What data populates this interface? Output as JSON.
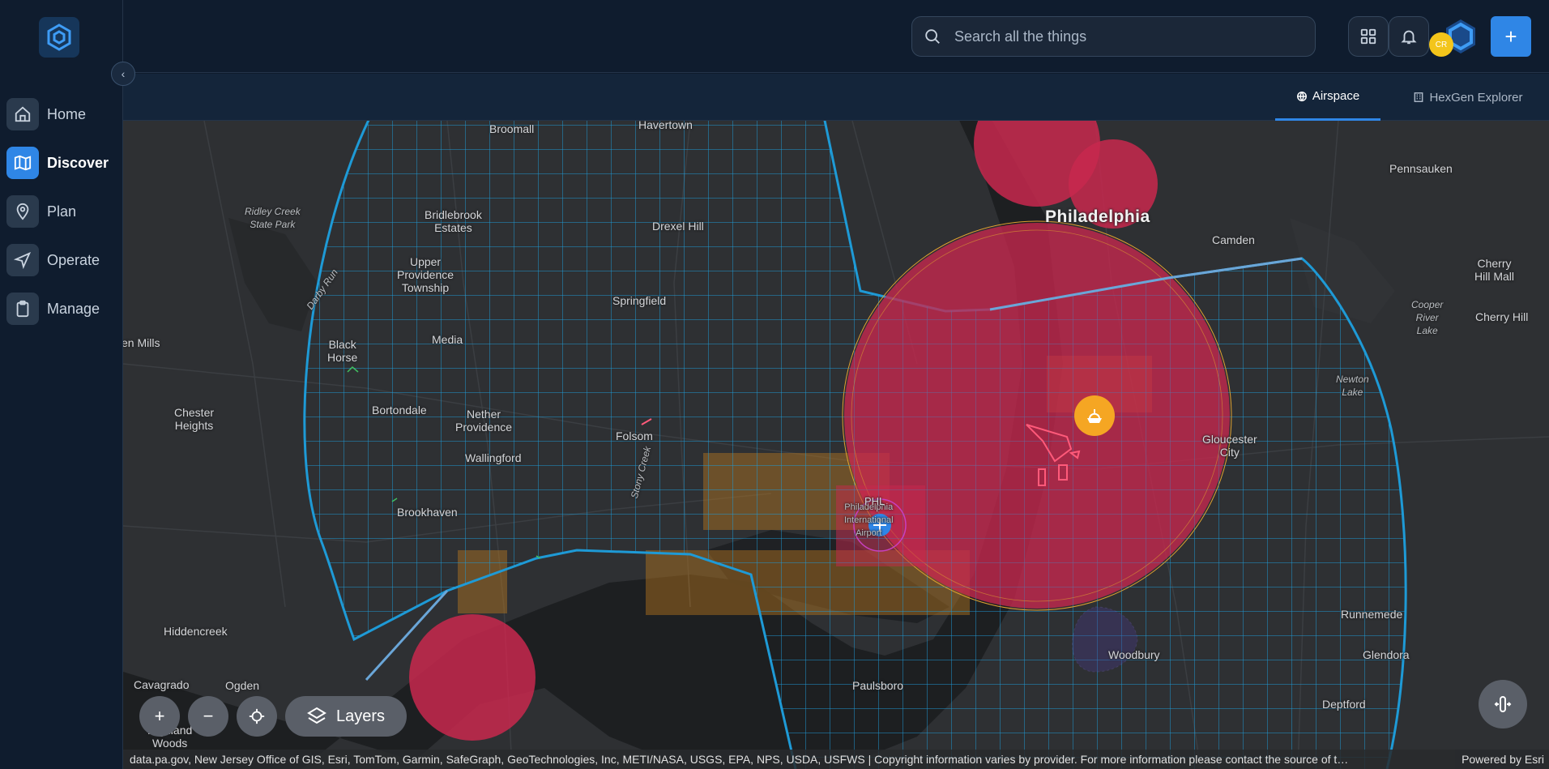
{
  "app": {
    "logo": "hexagon-logo-icon"
  },
  "sidebar": {
    "collapse_icon": "chevron-left-icon",
    "items": [
      {
        "label": "Home",
        "icon": "home-icon",
        "active": false
      },
      {
        "label": "Discover",
        "icon": "map-icon",
        "active": true
      },
      {
        "label": "Plan",
        "icon": "map-pin-icon",
        "active": false
      },
      {
        "label": "Operate",
        "icon": "send-icon",
        "active": false
      },
      {
        "label": "Manage",
        "icon": "clipboard-icon",
        "active": false
      }
    ]
  },
  "header": {
    "search_placeholder": "Search all the things",
    "avatar_initials": "CR",
    "accent": "#2f86e6"
  },
  "tabs": [
    {
      "label": "Airspace",
      "icon": "globe-icon",
      "active": true
    },
    {
      "label": "HexGen Explorer",
      "icon": "building-icon",
      "active": false
    }
  ],
  "map": {
    "places": {
      "broomall": "Broomall",
      "havertown": "Havertown",
      "pennsauken": "Pennsauken",
      "ridley": "Ridley Creek\nState Park",
      "bridlebrook": "Bridlebrook\nEstates",
      "drexel": "Drexel Hill",
      "philadelphia": "Philadelphia",
      "camden": "Camden",
      "cherry_mall": "Cherry\nHill Mall",
      "upper_providence": "Upper\nProvidence\nTownship",
      "darby_run": "Darby Run",
      "springfield": "Springfield",
      "cooper": "Cooper\nRiver\nLake",
      "cherry_hill": "Cherry Hill",
      "glen_mills": "en Mills",
      "black_horse": "Black\nHorse",
      "media": "Media",
      "newton": "Newton\nLake",
      "chester_heights": "Chester\nHeights",
      "bortondale": "Bortondale",
      "nether": "Nether\nProvidence",
      "folsom": "Folsom",
      "gloucester": "Gloucester\nCity",
      "wallingford": "Wallingford",
      "stony": "Stony Creek",
      "airport": "Philadelphia\nInternational\nAirport",
      "phl": "PHL",
      "brookhaven": "Brookhaven",
      "runnemede": "Runnemede",
      "hiddencreek": "Hiddencreek",
      "woodbury": "Woodbury",
      "glendora": "Glendora",
      "cavagrado": "Cavagrado",
      "ogden": "Ogden",
      "paulsboro": "Paulsboro",
      "deptford": "Deptford",
      "highland": "Highland\nWoods"
    },
    "controls": {
      "zoom_in": "+",
      "zoom_out": "−",
      "locate_icon": "crosshair-icon",
      "layers_label": "Layers",
      "layers_icon": "layers-icon",
      "rotate_icon": "compass-icon"
    },
    "attribution": "data.pa.gov, New Jersey Office of GIS, Esri, TomTom, Garmin, SafeGraph, GeoTechnologies, Inc, METI/NASA, USGS, EPA, NPS, USDA, USFWS | Copyright information varies by provider. For more information please contact the source of t…",
    "powered_by": "Powered by Esri",
    "colors": {
      "grid": "#1e9ad6",
      "restricted": "#c8284e",
      "caution": "#b8771e",
      "marker": "#f5a623"
    }
  }
}
